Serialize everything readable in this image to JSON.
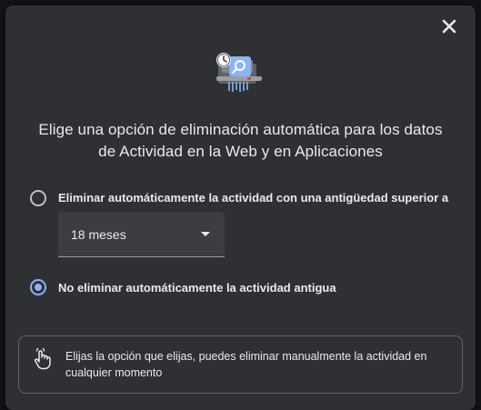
{
  "dialog": {
    "close_icon": "close-icon",
    "hero_icon": "clock-search-shredder-icon",
    "title_line1": "Elige una opción de eliminación automática para los datos",
    "title_line2": "de Actividad en la Web y en Aplicaciones"
  },
  "options": [
    {
      "label": "Eliminar automáticamente la actividad con una antigüedad superior a",
      "selected": false
    },
    {
      "label": "No eliminar automáticamente la actividad antigua",
      "selected": true
    }
  ],
  "period_select": {
    "value": "18 meses"
  },
  "info": {
    "icon": "hand-pointer-icon",
    "text": "Elijas la opción que elijas, puedes eliminar manualmente la actividad en cualquier momento"
  },
  "colors": {
    "dialog_bg": "#2f3033",
    "text": "#e8eaed",
    "accent": "#8ab4f8",
    "border": "#5f6368"
  }
}
